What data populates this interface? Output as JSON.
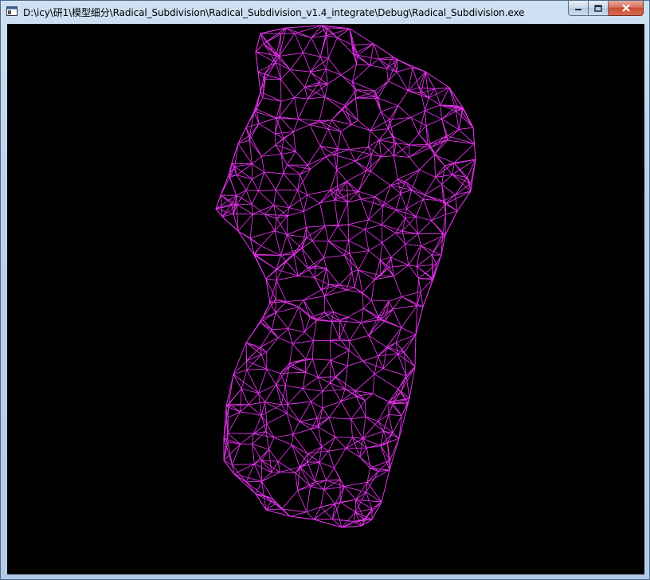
{
  "window": {
    "title": "D:\\icy\\研1\\模型细分\\Radical_Subdivision\\Radical_Subdivision_v1.4_integrate\\Debug\\Radical_Subdivision.exe"
  },
  "controls": {
    "minimize_icon": "minimize-icon",
    "maximize_icon": "maximize-icon",
    "close_icon": "close-icon"
  },
  "viewport": {
    "background": "#000000",
    "mesh_color": "#e030e8",
    "content": "wireframe torso mesh"
  }
}
